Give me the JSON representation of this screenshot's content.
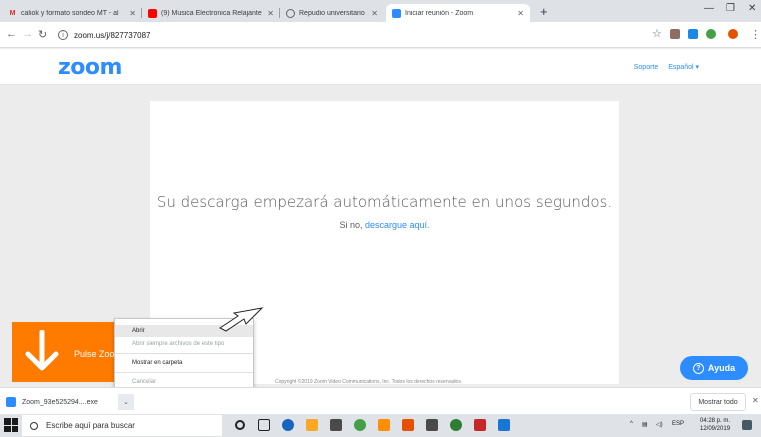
{
  "browser": {
    "tabs": [
      {
        "title": "caliok y formato sondeo MT - al",
        "favicon": "gmail-icon",
        "color": "#d93025"
      },
      {
        "title": "(9) Musica Electronica Relajante |",
        "favicon": "youtube-icon",
        "color": "#ff0000"
      },
      {
        "title": "Repudio universitario a las provo",
        "favicon": "site-icon",
        "color": "#5f6368"
      },
      {
        "title": "Iniciar reunión - Zoom",
        "favicon": "zoom-icon",
        "color": "#2d8cff"
      }
    ],
    "new_tab": "+",
    "url": "zoom.us/j/827737087"
  },
  "zoom_header": {
    "logo": "zoom",
    "support": "Soporte",
    "language": "Español ▾"
  },
  "main": {
    "message": "Su descarga empezará automáticamente en unos segundos.",
    "sub_prefix": "Si no,",
    "sub_link": "descargue aquí.",
    "copyright": "Copyright ©2019 Zoom Video Communications, Inc. Todos los derechos reservados."
  },
  "banner": {
    "text": "Pulse Zoo"
  },
  "context_menu": {
    "items": [
      "Abrir",
      "Abrir siempre archivos de este tipo",
      "Mostrar en carpeta",
      "Cancelar"
    ]
  },
  "help_button": "Ayuda",
  "download_shelf": {
    "filename": "Zoom_93e525294....exe",
    "show_all": "Mostrar todo"
  },
  "taskbar": {
    "search_placeholder": "Escribe aquí para buscar",
    "lang": "ESP",
    "time": "04:28 p. m.",
    "date": "12/09/2019"
  },
  "colors": {
    "zoom_blue": "#2d8cff",
    "banner_orange": "#ff7b00"
  }
}
